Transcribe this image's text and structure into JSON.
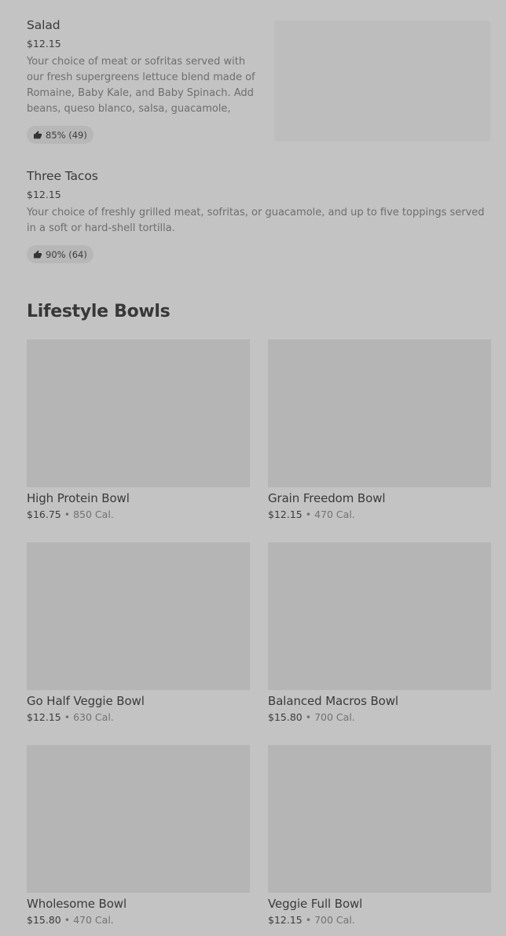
{
  "list_items": [
    {
      "name": "Salad",
      "price": "$12.15",
      "description": "Your choice of meat or sofritas served with our fresh supergreens lettuce blend made of Romaine, Baby Kale, and Baby Spinach. Add beans, queso blanco, salsa, guacamole, sour…",
      "rating": "85% (49)"
    },
    {
      "name": "Three Tacos",
      "price": "$12.15",
      "description": "Your choice of freshly grilled meat, sofritas, or guacamole, and up to five toppings served in a soft or hard-shell tortilla.",
      "rating": "90% (64)"
    }
  ],
  "section": {
    "title": "Lifestyle Bowls",
    "items": [
      {
        "name": "High Protein Bowl",
        "price": "$16.75",
        "separator": "•",
        "calories": "850 Cal."
      },
      {
        "name": "Grain Freedom Bowl",
        "price": "$12.15",
        "separator": "•",
        "calories": "470 Cal."
      },
      {
        "name": "Go Half Veggie Bowl",
        "price": "$12.15",
        "separator": "•",
        "calories": "630 Cal."
      },
      {
        "name": "Balanced Macros Bowl",
        "price": "$15.80",
        "separator": "•",
        "calories": "700 Cal."
      },
      {
        "name": "Wholesome Bowl",
        "price": "$15.80",
        "separator": "•",
        "calories": "470 Cal."
      },
      {
        "name": "Veggie Full Bowl",
        "price": "$12.15",
        "separator": "•",
        "calories": "700 Cal."
      }
    ]
  },
  "icons": {
    "rating": "thumbs-up-icon"
  },
  "colors": {
    "background": "#c3c3c3",
    "image_placeholder": "#b5b5b5",
    "rating_pill": "#b7b7b7"
  }
}
